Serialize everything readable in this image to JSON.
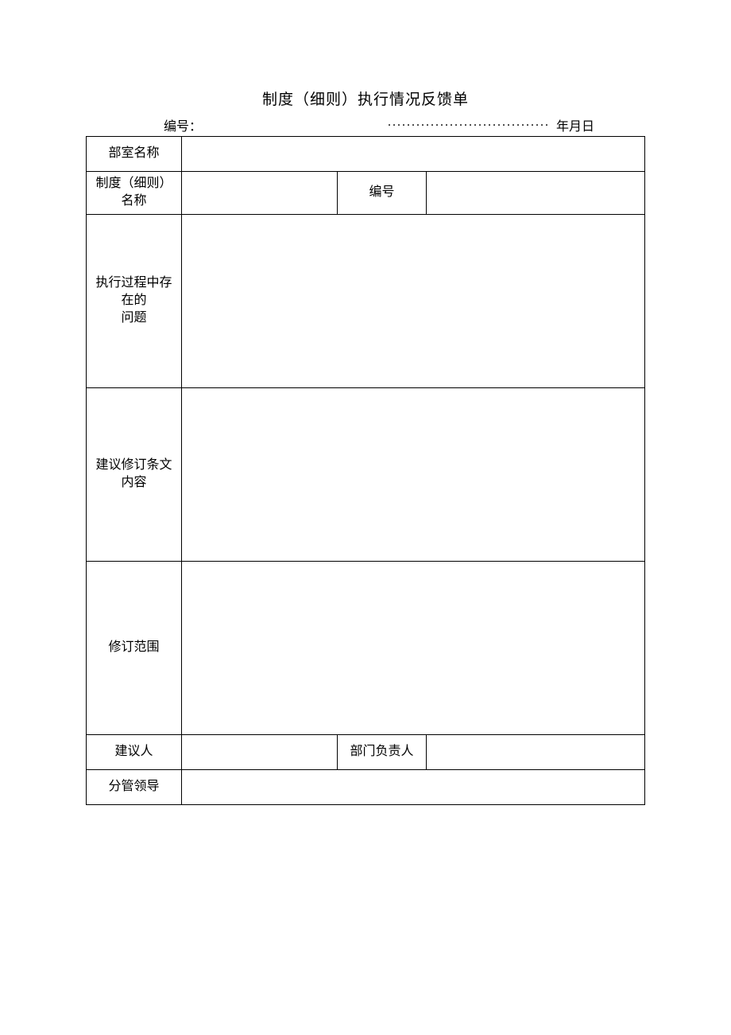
{
  "title": "制度（细则）执行情况反馈单",
  "meta": {
    "number_label": "编号：",
    "dots": "..................................",
    "date_suffix": "年月日"
  },
  "labels": {
    "dept_name": "部室名称",
    "rule_name": "制度（细则）名称",
    "number": "编号",
    "issues_line1": "执行过程中存在的",
    "issues_line2": "问题",
    "suggestion": "建议修订条文内容",
    "scope": "修订范围",
    "proposer": "建议人",
    "dept_head": "部门负责人",
    "leader": "分管领导"
  },
  "values": {
    "dept_name": "",
    "rule_name": "",
    "rule_number": "",
    "issues": "",
    "suggestion": "",
    "scope": "",
    "proposer": "",
    "dept_head": "",
    "leader": ""
  }
}
